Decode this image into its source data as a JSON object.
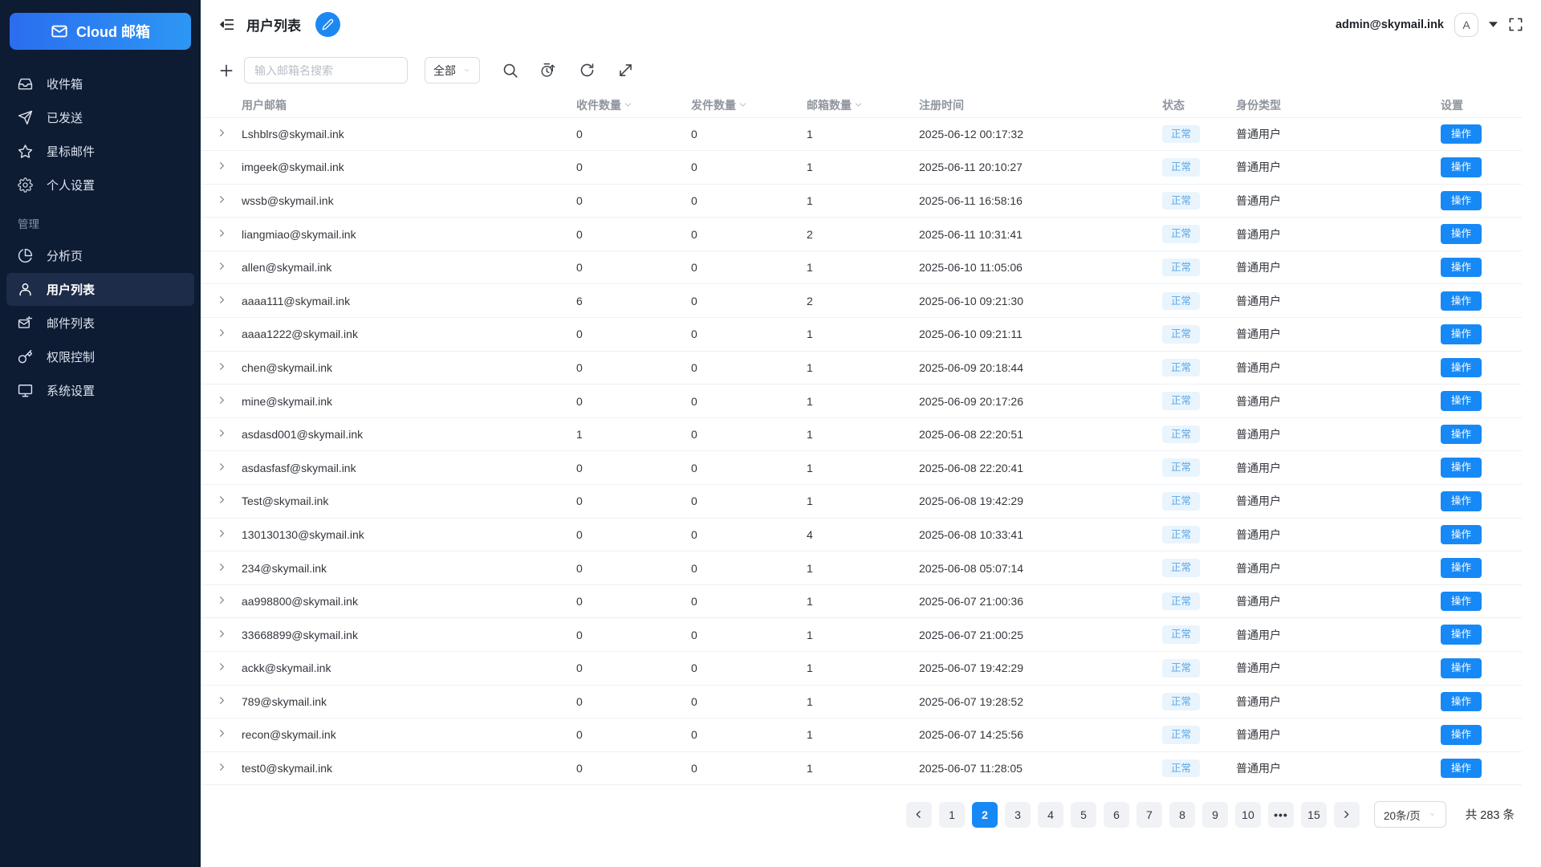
{
  "colors": {
    "accent_blue": "#1789f6",
    "sidebar_bg": "#0d1b33",
    "sidebar_active_bg": "#1d2c49",
    "logo_gradient_start": "#2b6df0",
    "logo_gradient_end": "#2c97f4",
    "badge_bg": "#e9f4fd",
    "badge_text": "#5aa7e6",
    "row_divider": "#edf0f7"
  },
  "sidebar": {
    "logo": {
      "label": "Cloud 邮箱",
      "icon": "envelope-icon"
    },
    "items": [
      {
        "type": "item",
        "key": "inbox",
        "label": "收件箱",
        "icon": "inbox-icon",
        "active": false
      },
      {
        "type": "item",
        "key": "sent",
        "label": "已发送",
        "icon": "send-icon",
        "active": false
      },
      {
        "type": "item",
        "key": "starred",
        "label": "星标邮件",
        "icon": "star-icon",
        "active": false
      },
      {
        "type": "item",
        "key": "personal-settings",
        "label": "个人设置",
        "icon": "gear-icon",
        "active": false
      },
      {
        "type": "section",
        "label": "管理"
      },
      {
        "type": "item",
        "key": "analytics",
        "label": "分析页",
        "icon": "pie-chart-icon",
        "active": false
      },
      {
        "type": "item",
        "key": "user-list",
        "label": "用户列表",
        "icon": "user-icon",
        "active": true
      },
      {
        "type": "item",
        "key": "mail-list",
        "label": "邮件列表",
        "icon": "mail-list-icon",
        "active": false
      },
      {
        "type": "item",
        "key": "permissions",
        "label": "权限控制",
        "icon": "key-icon",
        "active": false
      },
      {
        "type": "item",
        "key": "system-settings",
        "label": "系统设置",
        "icon": "monitor-icon",
        "active": false
      }
    ]
  },
  "header": {
    "title": "用户列表",
    "account_email": "admin@skymail.ink",
    "avatar_letter": "A"
  },
  "toolbar": {
    "search_placeholder": "输入邮箱名搜索",
    "filter_selected": "全部"
  },
  "table": {
    "columns": [
      {
        "key": "email",
        "label": "用户邮箱",
        "sortable": false
      },
      {
        "key": "inbound",
        "label": "收件数量",
        "sortable": true
      },
      {
        "key": "outbound",
        "label": "发件数量",
        "sortable": true
      },
      {
        "key": "mailboxes",
        "label": "邮箱数量",
        "sortable": true
      },
      {
        "key": "registered",
        "label": "注册时间",
        "sortable": false
      },
      {
        "key": "status",
        "label": "状态",
        "sortable": false
      },
      {
        "key": "role",
        "label": "身份类型",
        "sortable": false
      },
      {
        "key": "settings",
        "label": "设置",
        "sortable": false
      }
    ],
    "rows": [
      {
        "email": "Lshblrs@skymail.ink",
        "inbound": "0",
        "outbound": "0",
        "mailboxes": "1",
        "registered": "2025-06-12 00:17:32",
        "status": "正常",
        "role": "普通用户",
        "action": "操作"
      },
      {
        "email": "imgeek@skymail.ink",
        "inbound": "0",
        "outbound": "0",
        "mailboxes": "1",
        "registered": "2025-06-11 20:10:27",
        "status": "正常",
        "role": "普通用户",
        "action": "操作"
      },
      {
        "email": "wssb@skymail.ink",
        "inbound": "0",
        "outbound": "0",
        "mailboxes": "1",
        "registered": "2025-06-11 16:58:16",
        "status": "正常",
        "role": "普通用户",
        "action": "操作"
      },
      {
        "email": "liangmiao@skymail.ink",
        "inbound": "0",
        "outbound": "0",
        "mailboxes": "2",
        "registered": "2025-06-11 10:31:41",
        "status": "正常",
        "role": "普通用户",
        "action": "操作"
      },
      {
        "email": "allen@skymail.ink",
        "inbound": "0",
        "outbound": "0",
        "mailboxes": "1",
        "registered": "2025-06-10 11:05:06",
        "status": "正常",
        "role": "普通用户",
        "action": "操作"
      },
      {
        "email": "aaaa111@skymail.ink",
        "inbound": "6",
        "outbound": "0",
        "mailboxes": "2",
        "registered": "2025-06-10 09:21:30",
        "status": "正常",
        "role": "普通用户",
        "action": "操作"
      },
      {
        "email": "aaaa1222@skymail.ink",
        "inbound": "0",
        "outbound": "0",
        "mailboxes": "1",
        "registered": "2025-06-10 09:21:11",
        "status": "正常",
        "role": "普通用户",
        "action": "操作"
      },
      {
        "email": "chen@skymail.ink",
        "inbound": "0",
        "outbound": "0",
        "mailboxes": "1",
        "registered": "2025-06-09 20:18:44",
        "status": "正常",
        "role": "普通用户",
        "action": "操作"
      },
      {
        "email": "mine@skymail.ink",
        "inbound": "0",
        "outbound": "0",
        "mailboxes": "1",
        "registered": "2025-06-09 20:17:26",
        "status": "正常",
        "role": "普通用户",
        "action": "操作"
      },
      {
        "email": "asdasd001@skymail.ink",
        "inbound": "1",
        "outbound": "0",
        "mailboxes": "1",
        "registered": "2025-06-08 22:20:51",
        "status": "正常",
        "role": "普通用户",
        "action": "操作"
      },
      {
        "email": "asdasfasf@skymail.ink",
        "inbound": "0",
        "outbound": "0",
        "mailboxes": "1",
        "registered": "2025-06-08 22:20:41",
        "status": "正常",
        "role": "普通用户",
        "action": "操作"
      },
      {
        "email": "Test@skymail.ink",
        "inbound": "0",
        "outbound": "0",
        "mailboxes": "1",
        "registered": "2025-06-08 19:42:29",
        "status": "正常",
        "role": "普通用户",
        "action": "操作"
      },
      {
        "email": "130130130@skymail.ink",
        "inbound": "0",
        "outbound": "0",
        "mailboxes": "4",
        "registered": "2025-06-08 10:33:41",
        "status": "正常",
        "role": "普通用户",
        "action": "操作"
      },
      {
        "email": "234@skymail.ink",
        "inbound": "0",
        "outbound": "0",
        "mailboxes": "1",
        "registered": "2025-06-08 05:07:14",
        "status": "正常",
        "role": "普通用户",
        "action": "操作"
      },
      {
        "email": "aa998800@skymail.ink",
        "inbound": "0",
        "outbound": "0",
        "mailboxes": "1",
        "registered": "2025-06-07 21:00:36",
        "status": "正常",
        "role": "普通用户",
        "action": "操作"
      },
      {
        "email": "33668899@skymail.ink",
        "inbound": "0",
        "outbound": "0",
        "mailboxes": "1",
        "registered": "2025-06-07 21:00:25",
        "status": "正常",
        "role": "普通用户",
        "action": "操作"
      },
      {
        "email": "ackk@skymail.ink",
        "inbound": "0",
        "outbound": "0",
        "mailboxes": "1",
        "registered": "2025-06-07 19:42:29",
        "status": "正常",
        "role": "普通用户",
        "action": "操作"
      },
      {
        "email": "789@skymail.ink",
        "inbound": "0",
        "outbound": "0",
        "mailboxes": "1",
        "registered": "2025-06-07 19:28:52",
        "status": "正常",
        "role": "普通用户",
        "action": "操作"
      },
      {
        "email": "recon@skymail.ink",
        "inbound": "0",
        "outbound": "0",
        "mailboxes": "1",
        "registered": "2025-06-07 14:25:56",
        "status": "正常",
        "role": "普通用户",
        "action": "操作"
      },
      {
        "email": "test0@skymail.ink",
        "inbound": "0",
        "outbound": "0",
        "mailboxes": "1",
        "registered": "2025-06-07 11:28:05",
        "status": "正常",
        "role": "普通用户",
        "action": "操作"
      }
    ]
  },
  "pagination": {
    "pages": [
      "1",
      "2",
      "3",
      "4",
      "5",
      "6",
      "7",
      "8",
      "9",
      "10",
      "•••",
      "15"
    ],
    "current": "2",
    "page_size": "20条/页",
    "total_text": "共 283 条"
  }
}
